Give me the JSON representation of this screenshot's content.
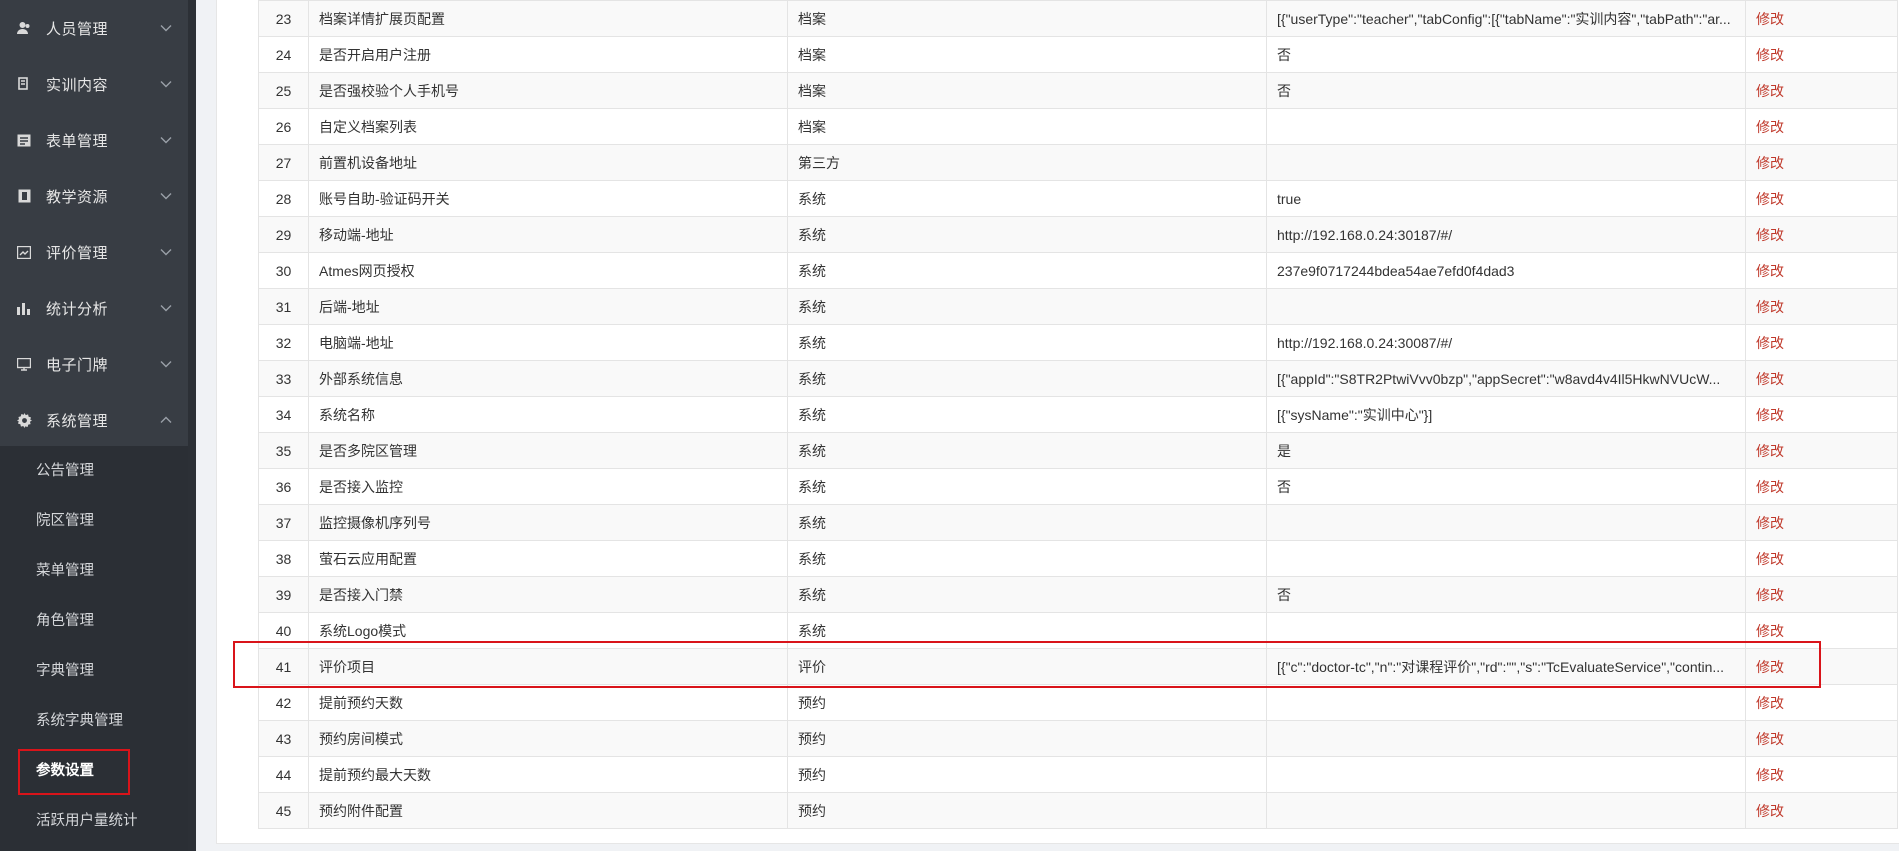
{
  "sidebar": {
    "groups": [
      {
        "label": "人员管理",
        "icon": "user-icon",
        "arrow": "chevron-down-icon"
      },
      {
        "label": "实训内容",
        "icon": "document-icon",
        "arrow": "chevron-down-icon"
      },
      {
        "label": "表单管理",
        "icon": "form-icon",
        "arrow": "chevron-down-icon"
      },
      {
        "label": "教学资源",
        "icon": "resource-icon",
        "arrow": "chevron-down-icon"
      },
      {
        "label": "评价管理",
        "icon": "evaluation-icon",
        "arrow": "chevron-down-icon"
      },
      {
        "label": "统计分析",
        "icon": "bar-chart-icon",
        "arrow": "chevron-down-icon"
      },
      {
        "label": "电子门牌",
        "icon": "monitor-icon",
        "arrow": "chevron-down-icon"
      },
      {
        "label": "系统管理",
        "icon": "gear-icon",
        "arrow": "chevron-up-icon"
      }
    ],
    "submenu": [
      {
        "label": "公告管理"
      },
      {
        "label": "院区管理"
      },
      {
        "label": "菜单管理"
      },
      {
        "label": "角色管理"
      },
      {
        "label": "字典管理"
      },
      {
        "label": "系统字典管理"
      },
      {
        "label": "参数设置",
        "active": true
      },
      {
        "label": "活跃用户量统计"
      }
    ]
  },
  "table": {
    "action_label": "修改",
    "rows": [
      {
        "idx": "23",
        "name": "档案详情扩展页配置",
        "type": "档案",
        "value": "[{\"userType\":\"teacher\",\"tabConfig\":[{\"tabName\":\"实训内容\",\"tabPath\":\"ar..."
      },
      {
        "idx": "24",
        "name": "是否开启用户注册",
        "type": "档案",
        "value": "否"
      },
      {
        "idx": "25",
        "name": "是否强校验个人手机号",
        "type": "档案",
        "value": "否"
      },
      {
        "idx": "26",
        "name": "自定义档案列表",
        "type": "档案",
        "value": ""
      },
      {
        "idx": "27",
        "name": "前置机设备地址",
        "type": "第三方",
        "value": ""
      },
      {
        "idx": "28",
        "name": "账号自助-验证码开关",
        "type": "系统",
        "value": "true"
      },
      {
        "idx": "29",
        "name": "移动端-地址",
        "type": "系统",
        "value": "http://192.168.0.24:30187/#/"
      },
      {
        "idx": "30",
        "name": "Atmes网页授权",
        "type": "系统",
        "value": "237e9f0717244bdea54ae7efd0f4dad3"
      },
      {
        "idx": "31",
        "name": "后端-地址",
        "type": "系统",
        "value": ""
      },
      {
        "idx": "32",
        "name": "电脑端-地址",
        "type": "系统",
        "value": "http://192.168.0.24:30087/#/"
      },
      {
        "idx": "33",
        "name": "外部系统信息",
        "type": "系统",
        "value": "[{\"appId\":\"S8TR2PtwiVvv0bzp\",\"appSecret\":\"w8avd4v4Il5HkwNVUcW..."
      },
      {
        "idx": "34",
        "name": "系统名称",
        "type": "系统",
        "value": "[{\"sysName\":\"实训中心\"}]"
      },
      {
        "idx": "35",
        "name": "是否多院区管理",
        "type": "系统",
        "value": "是"
      },
      {
        "idx": "36",
        "name": "是否接入监控",
        "type": "系统",
        "value": "否"
      },
      {
        "idx": "37",
        "name": "监控摄像机序列号",
        "type": "系统",
        "value": ""
      },
      {
        "idx": "38",
        "name": "萤石云应用配置",
        "type": "系统",
        "value": ""
      },
      {
        "idx": "39",
        "name": "是否接入门禁",
        "type": "系统",
        "value": "否"
      },
      {
        "idx": "40",
        "name": "系统Logo模式",
        "type": "系统",
        "value": ""
      },
      {
        "idx": "41",
        "name": "评价项目",
        "type": "评价",
        "value": "[{\"c\":\"doctor-tc\",\"n\":\"对课程评价\",\"rd\":\"\",\"s\":\"TcEvaluateService\",\"contin..."
      },
      {
        "idx": "42",
        "name": "提前预约天数",
        "type": "预约",
        "value": ""
      },
      {
        "idx": "43",
        "name": "预约房间模式",
        "type": "预约",
        "value": ""
      },
      {
        "idx": "44",
        "name": "提前预约最大天数",
        "type": "预约",
        "value": ""
      },
      {
        "idx": "45",
        "name": "预约附件配置",
        "type": "预约",
        "value": ""
      }
    ]
  },
  "colors": {
    "sidebar_bg": "#383d44",
    "submenu_bg": "#2b2f35",
    "action_link": "#c0392b",
    "highlight_border": "#d9141a"
  }
}
